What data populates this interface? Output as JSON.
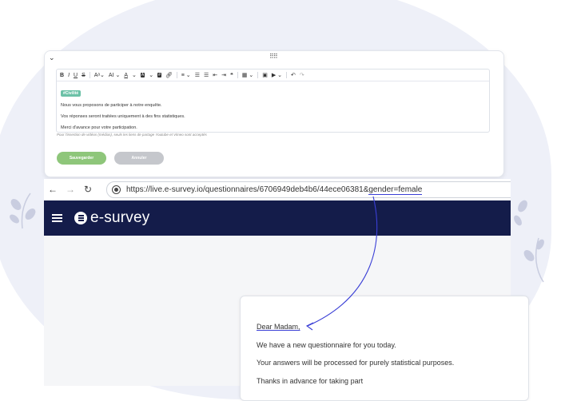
{
  "editor": {
    "toolbar": {
      "font_size_label": "A",
      "superscript_label": "ᵃ",
      "line_height_label": "A",
      "text_color_label": "A",
      "quote_label": "❝"
    },
    "tag_label": "#Civilité",
    "lines": [
      "Nous vous proposons de participer à notre enquête.",
      "Vos réponses seront traitées uniquement à des fins statistiques.",
      "Merci d'avance pour votre participation."
    ],
    "note": "Pour l'insertion de vidéos (médias), seuls les liens de partage Youtube et Vimeo sont acceptés",
    "save_label": "Sauvegarder",
    "cancel_label": "Annuler"
  },
  "browser": {
    "url_prefix": "https://live.e-survey.io/questionnaires/6706949deb4b6/44ece06381&",
    "url_param": "gender=female"
  },
  "app": {
    "logo_text": "e-survey"
  },
  "email": {
    "greeting": "Dear Madam,",
    "line1": "We have a new questionnaire for you today.",
    "line2": "Your answers will be processed for purely statistical purposes.",
    "line3": "Thanks in advance for taking part"
  },
  "colors": {
    "header_bg": "#141c4a",
    "tag_bg": "#6cc1a7",
    "save_bg": "#8ec67a",
    "cancel_bg": "#c5c7cc",
    "annotation": "#3a3fd6"
  }
}
